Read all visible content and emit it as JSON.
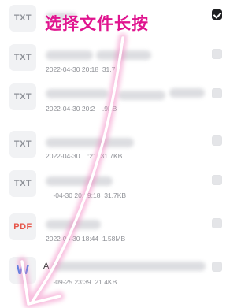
{
  "annotation": {
    "text": "选择文件长按",
    "color": "#e0158f"
  },
  "files": [
    {
      "icon": "TXT",
      "type": "txt",
      "meta": "",
      "name_fragment": "",
      "checked": true
    },
    {
      "icon": "TXT",
      "type": "txt",
      "meta": "2022-04-30 20:18  31.7",
      "name_fragment": "",
      "checked": false
    },
    {
      "icon": "TXT",
      "type": "txt",
      "meta": "2022-04-30 20:2    .9KB",
      "name_fragment": "",
      "checked": false
    },
    {
      "icon": "TXT",
      "type": "txt",
      "meta": "2022-04-30    :21  31.7KB",
      "name_fragment": "",
      "checked": false
    },
    {
      "icon": "TXT",
      "type": "txt",
      "meta": "    -04-30 20:19:18  31.7KB",
      "name_fragment": "",
      "checked": false
    },
    {
      "icon": "PDF",
      "type": "pdf",
      "meta": "2022-04-30 18:44  1.58MB",
      "name_fragment": "",
      "checked": false
    },
    {
      "icon": "W",
      "type": "word",
      "meta": "    -09-25 23:39  21.4KB",
      "name_fragment": "A",
      "checked": false
    }
  ]
}
